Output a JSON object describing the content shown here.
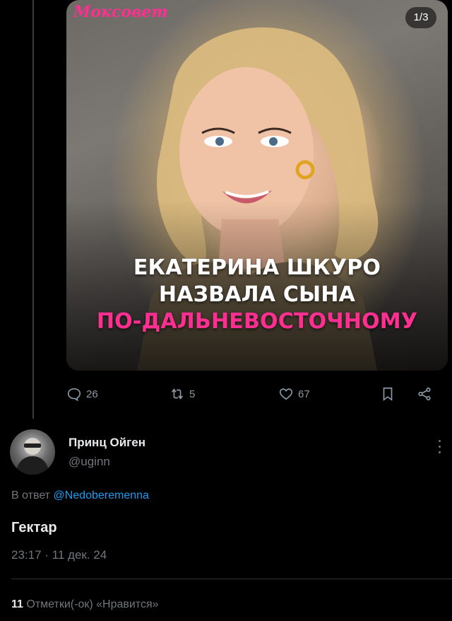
{
  "media": {
    "brand": "Моксовет",
    "counter": "1/3",
    "headline_line1": "ЕКАТЕРИНА ШКУРО",
    "headline_line2": "НАЗВАЛА СЫНА",
    "headline_line3": "ПО-ДАЛЬНЕВОСТОЧНОМУ",
    "accent_color": "#ff2f92"
  },
  "actions": {
    "replies": "26",
    "reposts": "5",
    "likes": "67",
    "reply_icon": "speech-bubble-icon",
    "repost_icon": "repost-icon",
    "like_icon": "heart-icon",
    "bookmark_icon": "bookmark-icon",
    "share_icon": "share-icon"
  },
  "author": {
    "name": "Принц Ойген",
    "handle": "@uginn"
  },
  "reply_to": {
    "prefix": "В ответ",
    "mention": "@Nedoberemenna"
  },
  "tweet": {
    "text": "Гектар",
    "timestamp": "23:17 · 11 дек. 24"
  },
  "stats": {
    "likes_count": "11",
    "likes_label": "Отметки(-ок) «Нравится»"
  }
}
